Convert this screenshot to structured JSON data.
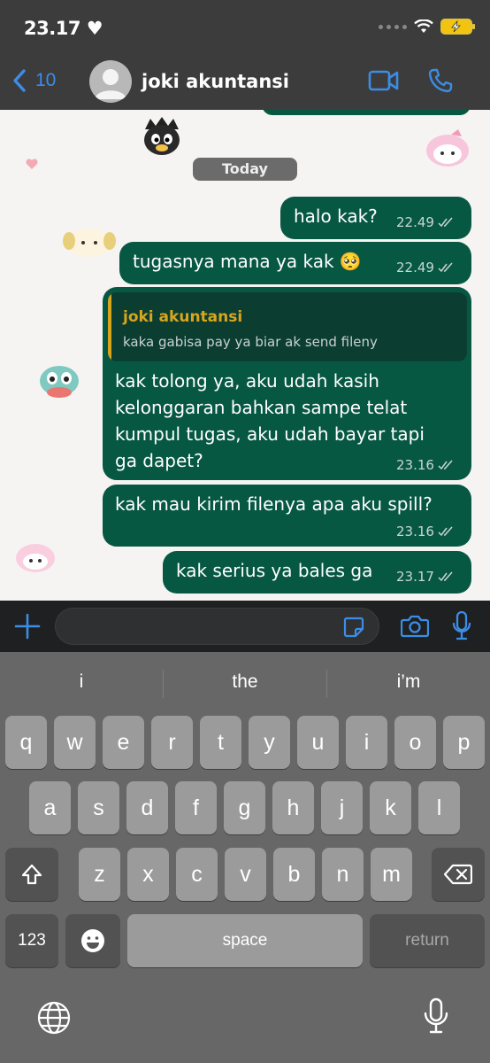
{
  "status": {
    "time": "23.17",
    "heart": "♥"
  },
  "header": {
    "back_count": "10",
    "contact_name": "joki akuntansi"
  },
  "chat": {
    "date_label": "Today",
    "messages": [
      {
        "text": "halo kak?",
        "time": "22.49"
      },
      {
        "text": "tugasnya mana ya kak 🥺",
        "time": "22.49"
      },
      {
        "reply_to": {
          "name": "joki akuntansi",
          "text": "kaka gabisa pay ya biar ak send fileny"
        },
        "lines": [
          "kak tolong ya, aku udah kasih",
          "kelonggaran bahkan sampe telat",
          "kumpul tugas, aku udah bayar tapi",
          "ga dapet?"
        ],
        "time": "23.16"
      },
      {
        "text": "kak mau kirim filenya apa aku spill?",
        "time": "23.16"
      },
      {
        "text": "kak serius ya bales ga",
        "time": "23.17"
      }
    ]
  },
  "keyboard": {
    "suggestions": [
      "i",
      "the",
      "i’m"
    ],
    "row1": [
      "q",
      "w",
      "e",
      "r",
      "t",
      "y",
      "u",
      "i",
      "o",
      "p"
    ],
    "row2": [
      "a",
      "s",
      "d",
      "f",
      "g",
      "h",
      "j",
      "k",
      "l"
    ],
    "row3": [
      "z",
      "x",
      "c",
      "v",
      "b",
      "n",
      "m"
    ],
    "numbers_label": "123",
    "space_label": "space",
    "return_label": "return"
  },
  "colors": {
    "bubble": "#075843",
    "accent": "#3b8de6",
    "quote_name": "#d8a51c"
  }
}
